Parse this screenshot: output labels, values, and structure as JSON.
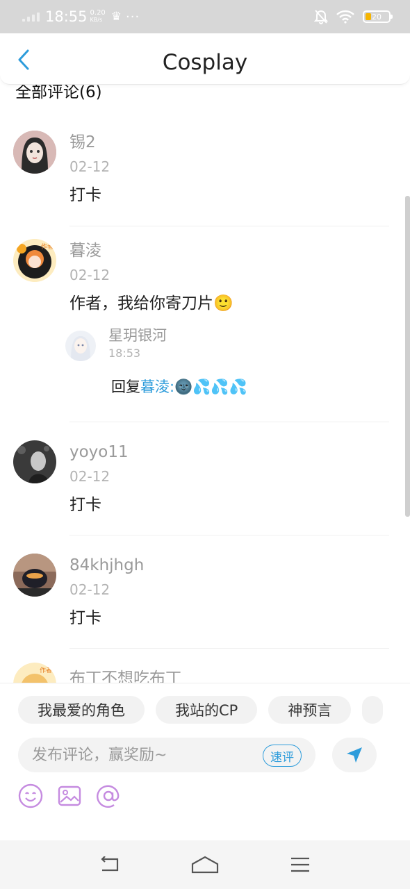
{
  "status_bar": {
    "time": "18:55",
    "speed": "0.20\nKB/s",
    "speed_top": "0.20",
    "speed_bottom": "KB/s",
    "battery": "20",
    "battery_color": "#f5b400"
  },
  "header": {
    "title": "Cosplay",
    "back_icon": "chevron-left-icon"
  },
  "section": {
    "title": "全部评论(6)"
  },
  "comments": [
    {
      "username": "锡2",
      "date": "02-12",
      "text": "打卡"
    },
    {
      "username": "暮淩",
      "date": "02-12",
      "text": "作者，我给你寄刀片🙂",
      "reply": {
        "username": "星玥银河",
        "time": "18:53",
        "prefix": "回复",
        "target": "暮淩:",
        "body": "🌚💦💦💦"
      }
    },
    {
      "username": "yoyo11",
      "date": "02-12",
      "text": "打卡"
    },
    {
      "username": "84khjhgh",
      "date": "02-12",
      "text": "打卡"
    },
    {
      "username": "布丁不想吃布丁"
    }
  ],
  "composer": {
    "chips": [
      "我最爱的角色",
      "我站的CP",
      "神预言"
    ],
    "placeholder": "发布评论，赢奖励~",
    "quick_label": "速评"
  },
  "colors": {
    "accent": "#2d9cdb",
    "tool_purple": "#c58be0"
  }
}
